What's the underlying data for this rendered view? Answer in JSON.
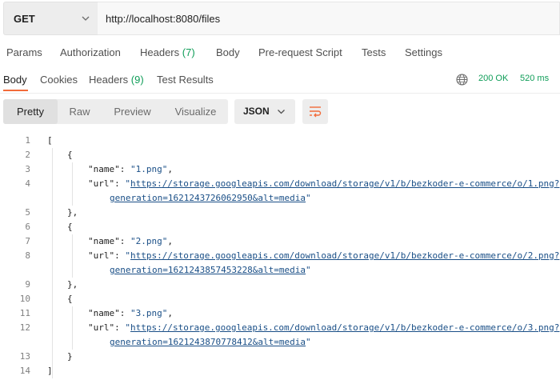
{
  "request": {
    "method": "GET",
    "url": "http://localhost:8080/files"
  },
  "request_tabs": {
    "params": "Params",
    "authorization": "Authorization",
    "headers_label": "Headers",
    "headers_count": "(7)",
    "body": "Body",
    "prerequest": "Pre-request Script",
    "tests": "Tests",
    "settings": "Settings"
  },
  "response_tabs": {
    "body": "Body",
    "cookies": "Cookies",
    "headers_label": "Headers",
    "headers_count": "(9)",
    "test_results": "Test Results"
  },
  "status": {
    "code": "200 OK",
    "time": "520 ms"
  },
  "view": {
    "pretty": "Pretty",
    "raw": "Raw",
    "preview": "Preview",
    "visualize": "Visualize",
    "format": "JSON"
  },
  "code": {
    "line_numbers": [
      "1",
      "2",
      "3",
      "4",
      "5",
      "6",
      "7",
      "8",
      "9",
      "10",
      "11",
      "12",
      "13",
      "14"
    ],
    "open_bracket": "[",
    "close_bracket": "]",
    "open_brace": "{",
    "close_brace": "}",
    "close_brace_comma": "},",
    "name_key": "\"name\"",
    "url_key": "\"url\"",
    "colon": ": ",
    "comma": ",",
    "quote": "\"",
    "items": [
      {
        "name": "\"1.png\"",
        "url_part1": "https://storage.googleapis.com/download/storage/v1/b/bezkoder-e-commerce/o/1.png?",
        "url_part2": "generation=1621243726062950&alt=media"
      },
      {
        "name": "\"2.png\"",
        "url_part1": "https://storage.googleapis.com/download/storage/v1/b/bezkoder-e-commerce/o/2.png?",
        "url_part2": "generation=1621243857453228&alt=media"
      },
      {
        "name": "\"3.png\"",
        "url_part1": "https://storage.googleapis.com/download/storage/v1/b/bezkoder-e-commerce/o/3.png?",
        "url_part2": "generation=1621243870778412&alt=media"
      }
    ]
  },
  "icons": {
    "method_dropdown": "chevron-down-icon",
    "globe": "globe-icon",
    "format_dropdown": "chevron-down-icon",
    "wrap": "wrap-lines-icon"
  },
  "colors": {
    "accent": "#f26b3a",
    "status_green": "#0f9d58",
    "string_blue": "#1a4f87"
  }
}
